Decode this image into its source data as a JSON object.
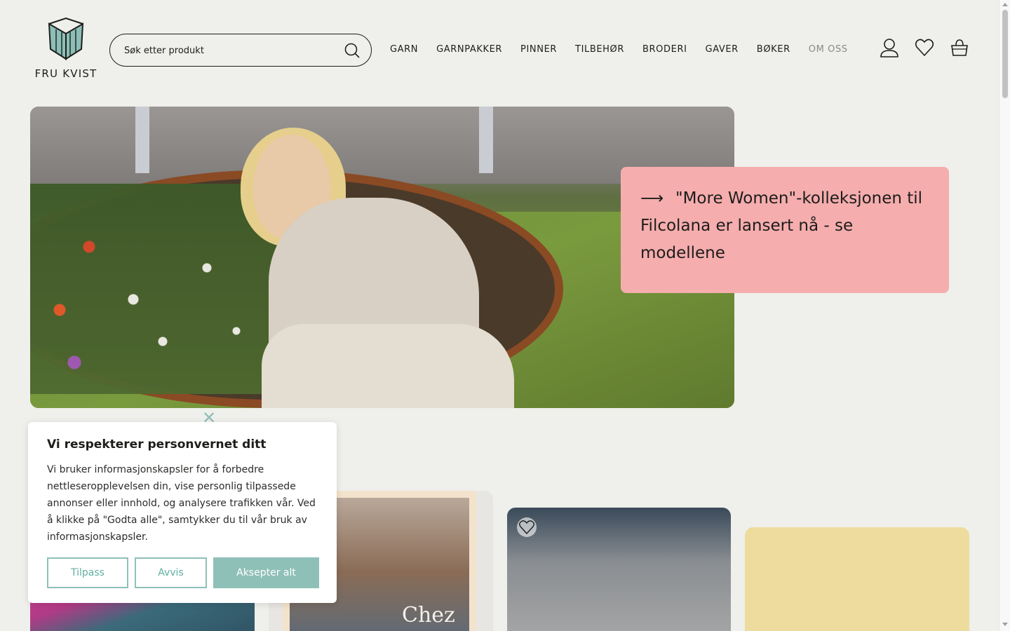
{
  "brand": {
    "name": "FRU KVIST"
  },
  "search": {
    "placeholder": "Søk etter produkt"
  },
  "nav": {
    "items": [
      {
        "label": "GARN"
      },
      {
        "label": "GARNPAKKER"
      },
      {
        "label": "PINNER"
      },
      {
        "label": "TILBEHØR"
      },
      {
        "label": "BRODERI"
      },
      {
        "label": "GAVER"
      },
      {
        "label": "BØKER"
      },
      {
        "label": "OM OSS"
      }
    ]
  },
  "header_icons": [
    "user-icon",
    "heart-icon",
    "basket-icon"
  ],
  "hero": {
    "promo_arrow": "⟶",
    "promo_text": "\"More Women\"-kolleksjonen til Filcolana er lansert nå - se modellene"
  },
  "products": {
    "book_title": "Chez"
  },
  "cookie": {
    "title": "Vi respekterer personvernet ditt",
    "body": "Vi bruker informasjonskapsler for å forbedre nettleseropplevelsen din, vise personlig tilpassede annonser eller innhold, og analysere trafikken vår. Ved å klikke på \"Godta alle\", samtykker du til vår bruk av informasjonskapsler.",
    "customize_label": "Tilpass",
    "reject_label": "Avvis",
    "accept_label": "Aksepter alt"
  },
  "colors": {
    "background": "#efefeb",
    "accent": "#8fc0b8",
    "promo": "#f5adae",
    "card_yellow": "#eedc9e"
  }
}
